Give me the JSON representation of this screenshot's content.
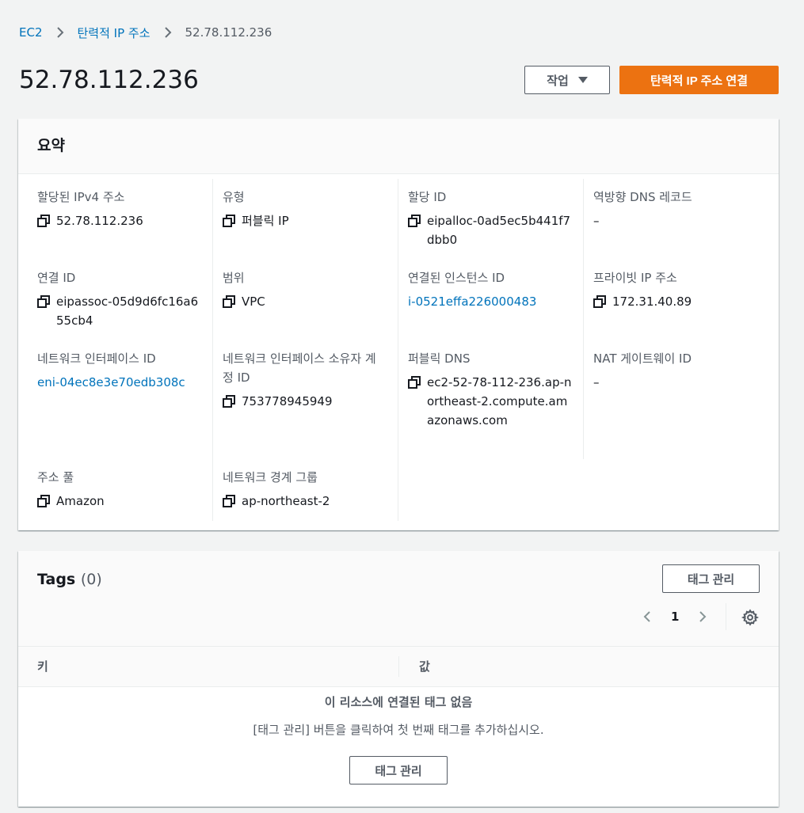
{
  "breadcrumb": {
    "items": [
      {
        "label": "EC2"
      },
      {
        "label": "탄력적 IP 주소"
      },
      {
        "label": "52.78.112.236"
      }
    ]
  },
  "header": {
    "title": "52.78.112.236",
    "actions_label": "작업",
    "primary_label": "탄력적 IP 주소 연결"
  },
  "summary": {
    "title": "요약",
    "fields": {
      "ipv4": {
        "label": "할당된 IPv4 주소",
        "value": "52.78.112.236"
      },
      "type": {
        "label": "유형",
        "value": "퍼블릭 IP"
      },
      "alloc_id": {
        "label": "할당 ID",
        "value": "eipalloc-0ad5ec5b441f7dbb0"
      },
      "reverse_dns": {
        "label": "역방향 DNS 레코드",
        "value": "–"
      },
      "assoc_id": {
        "label": "연결 ID",
        "value": "eipassoc-05d9d6fc16a655cb4"
      },
      "scope": {
        "label": "범위",
        "value": "VPC"
      },
      "instance_id": {
        "label": "연결된 인스턴스 ID",
        "value": "i-0521effa226000483"
      },
      "private_ip": {
        "label": "프라이빗 IP 주소",
        "value": "172.31.40.89"
      },
      "eni_id": {
        "label": "네트워크 인터페이스 ID",
        "value": "eni-04ec8e3e70edb308c"
      },
      "eni_owner": {
        "label": "네트워크 인터페이스 소유자 계정 ID",
        "value": "753778945949"
      },
      "public_dns": {
        "label": "퍼블릭 DNS",
        "value": "ec2-52-78-112-236.ap-northeast-2.compute.amazonaws.com"
      },
      "nat_gw": {
        "label": "NAT 게이트웨이 ID",
        "value": "–"
      },
      "pool": {
        "label": "주소 풀",
        "value": "Amazon"
      },
      "border_group": {
        "label": "네트워크 경계 그룹",
        "value": "ap-northeast-2"
      }
    }
  },
  "tags": {
    "title": "Tags",
    "count": "(0)",
    "manage_label": "태그 관리",
    "page": "1",
    "columns": {
      "key": "키",
      "value": "값"
    },
    "empty_title": "이 리소스에 연결된 태그 없음",
    "empty_desc": "[태그 관리] 버튼을 클릭하여 첫 번째 태그를 추가하십시오.",
    "empty_button": "태그 관리"
  },
  "icons": {
    "copy": "copy-icon",
    "chevron": "chevron-right-icon",
    "gear": "gear-icon"
  },
  "colors": {
    "link": "#0073bb",
    "primary": "#ec7211",
    "text": "#16191f",
    "muted": "#545b64",
    "background": "#f2f3f3"
  }
}
